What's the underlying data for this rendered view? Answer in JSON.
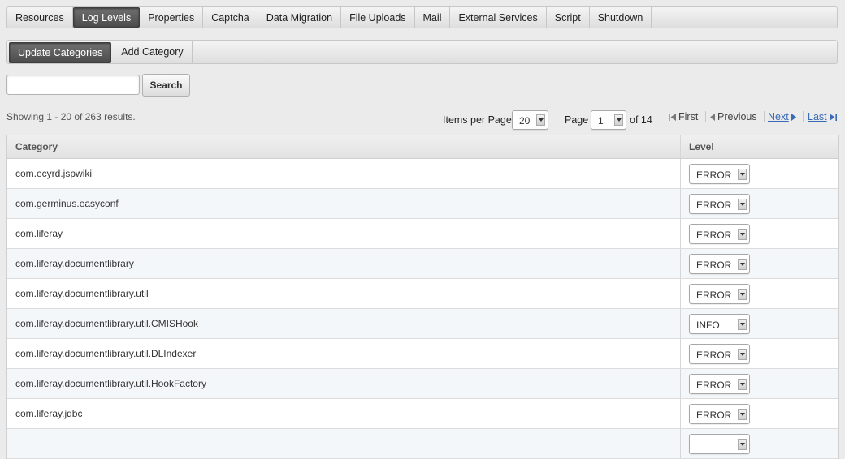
{
  "top_tabs": [
    {
      "label": "Resources",
      "active": false
    },
    {
      "label": "Log Levels",
      "active": true
    },
    {
      "label": "Properties",
      "active": false
    },
    {
      "label": "Captcha",
      "active": false
    },
    {
      "label": "Data Migration",
      "active": false
    },
    {
      "label": "File Uploads",
      "active": false
    },
    {
      "label": "Mail",
      "active": false
    },
    {
      "label": "External Services",
      "active": false
    },
    {
      "label": "Script",
      "active": false
    },
    {
      "label": "Shutdown",
      "active": false
    }
  ],
  "sub_tabs": [
    {
      "label": "Update Categories",
      "active": true
    },
    {
      "label": "Add Category",
      "active": false
    }
  ],
  "search": {
    "value": "",
    "button_label": "Search"
  },
  "results": {
    "showing_text": "Showing 1 - 20 of 263 results."
  },
  "pagination": {
    "items_per_page_label": "Items per Page",
    "items_per_page_value": "20",
    "page_label": "Page",
    "page_value": "1",
    "of_label": "of 14",
    "first_label": "First",
    "previous_label": "Previous",
    "next_label": "Next",
    "last_label": "Last"
  },
  "table": {
    "headers": {
      "category": "Category",
      "level": "Level"
    },
    "rows": [
      {
        "category": "com.ecyrd.jspwiki",
        "level": "ERROR"
      },
      {
        "category": "com.germinus.easyconf",
        "level": "ERROR"
      },
      {
        "category": "com.liferay",
        "level": "ERROR"
      },
      {
        "category": "com.liferay.documentlibrary",
        "level": "ERROR"
      },
      {
        "category": "com.liferay.documentlibrary.util",
        "level": "ERROR"
      },
      {
        "category": "com.liferay.documentlibrary.util.CMISHook",
        "level": "INFO"
      },
      {
        "category": "com.liferay.documentlibrary.util.DLIndexer",
        "level": "ERROR"
      },
      {
        "category": "com.liferay.documentlibrary.util.HookFactory",
        "level": "ERROR"
      },
      {
        "category": "com.liferay.jdbc",
        "level": "ERROR"
      },
      {
        "category": "",
        "level": ""
      }
    ]
  },
  "colors": {
    "active_tab": "#5a5a5a",
    "link": "#3a6ab5",
    "background": "#ebebeb"
  }
}
